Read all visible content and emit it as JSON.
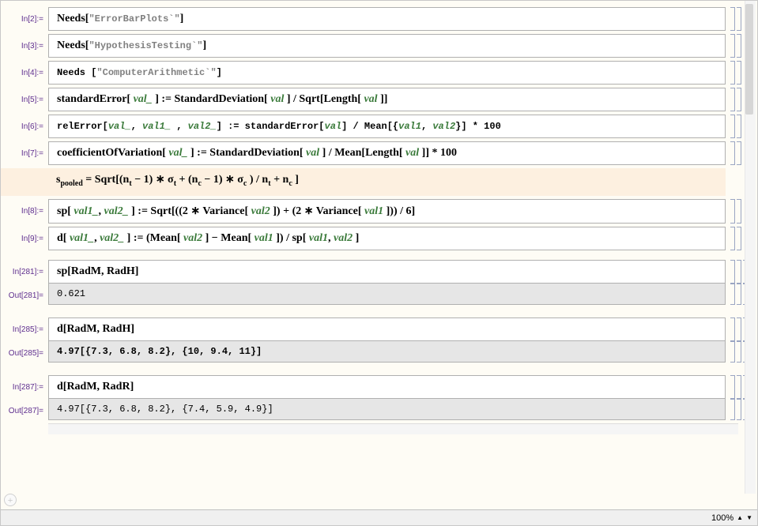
{
  "cells": {
    "c1": {
      "in": "In[2]:=",
      "fn": "Needs",
      "arg": "\"ErrorBarPlots`\""
    },
    "c2": {
      "in": "In[3]:=",
      "fn": "Needs",
      "arg": "\"HypothesisTesting`\""
    },
    "c3": {
      "in": "In[4]:=",
      "fn": "Needs",
      "arg": "\"ComputerArithmetic`\""
    },
    "c4": {
      "in": "In[5]:=",
      "pre1": "standardError[",
      "v1": " val_",
      "mid1": " ] := StandardDeviation[",
      "v2": " val",
      "mid2": " ] / Sqrt[Length[",
      "v3": " val",
      "post": " ]]"
    },
    "c5": {
      "in": "In[6]:=",
      "pre1": "relError[",
      "v1": "val_",
      "c1": ", ",
      "v2": "val1_",
      "c2": " , ",
      "v3": "val2_",
      "mid1": "] := standardError[",
      "v4": "val",
      "mid2": "] / Mean[{",
      "v5": "val1",
      "c3": ", ",
      "v6": "val2",
      "post": "}] * 100"
    },
    "c6": {
      "in": "In[7]:=",
      "pre1": "coefficientOfVariation[",
      "v1": " val_",
      "mid1": " ] := StandardDeviation[",
      "v2": " val",
      "mid2": " ] / Mean[Length[",
      "v3": " val",
      "post": " ]] * 100"
    },
    "text1_a": "s",
    "text1_sub1": "pooled",
    "text1_b": "  = Sqrt[(n",
    "text1_sub2": "t",
    "text1_c": " − 1) ∗ σ",
    "text1_sub3": "t",
    "text1_d": "  + (n",
    "text1_sub4": "c",
    "text1_e": "  − 1) ∗ σ",
    "text1_sub5": "c",
    "text1_f": " ) / n",
    "text1_sub6": "t",
    "text1_g": "  + n",
    "text1_sub7": "c",
    "text1_h": " ]",
    "c7": {
      "in": "In[8]:=",
      "pre1": "sp[",
      "v1": " val1_",
      "c1": ", ",
      "v2": " val2_",
      "mid1": " ] := Sqrt[((2 ∗ Variance[",
      "v3": " val2",
      "mid2": " ]) + (2 ∗ Variance[",
      "v4": " val1",
      "post": " ])) / 6]"
    },
    "c8": {
      "in": "In[9]:=",
      "pre1": "d[",
      "v1": " val1_",
      "c1": ", ",
      "v2": " val2_",
      "mid1": " ] :=  (Mean[",
      "v3": " val2",
      "mid2": " ] − Mean[",
      "v4": " val1",
      "mid3": " ]) / sp[",
      "v5": " val1",
      "c2": ", ",
      "v6": " val2",
      "post": " ]"
    },
    "c9": {
      "in": "In[281]:=",
      "expr": "sp[RadM, RadH]",
      "out": "Out[281]=",
      "result": "0.621"
    },
    "c10": {
      "in": "In[285]:=",
      "expr": "d[RadM, RadH]",
      "out": "Out[285]=",
      "result": "4.97[{7.3, 6.8, 8.2}, {10, 9.4, 11}]"
    },
    "c11": {
      "in": "In[287]:=",
      "expr": "d[RadM, RadR]",
      "out": "Out[287]=",
      "result": "4.97[{7.3, 6.8, 8.2}, {7.4, 5.9, 4.9}]"
    }
  },
  "status": {
    "zoom": "100%"
  }
}
